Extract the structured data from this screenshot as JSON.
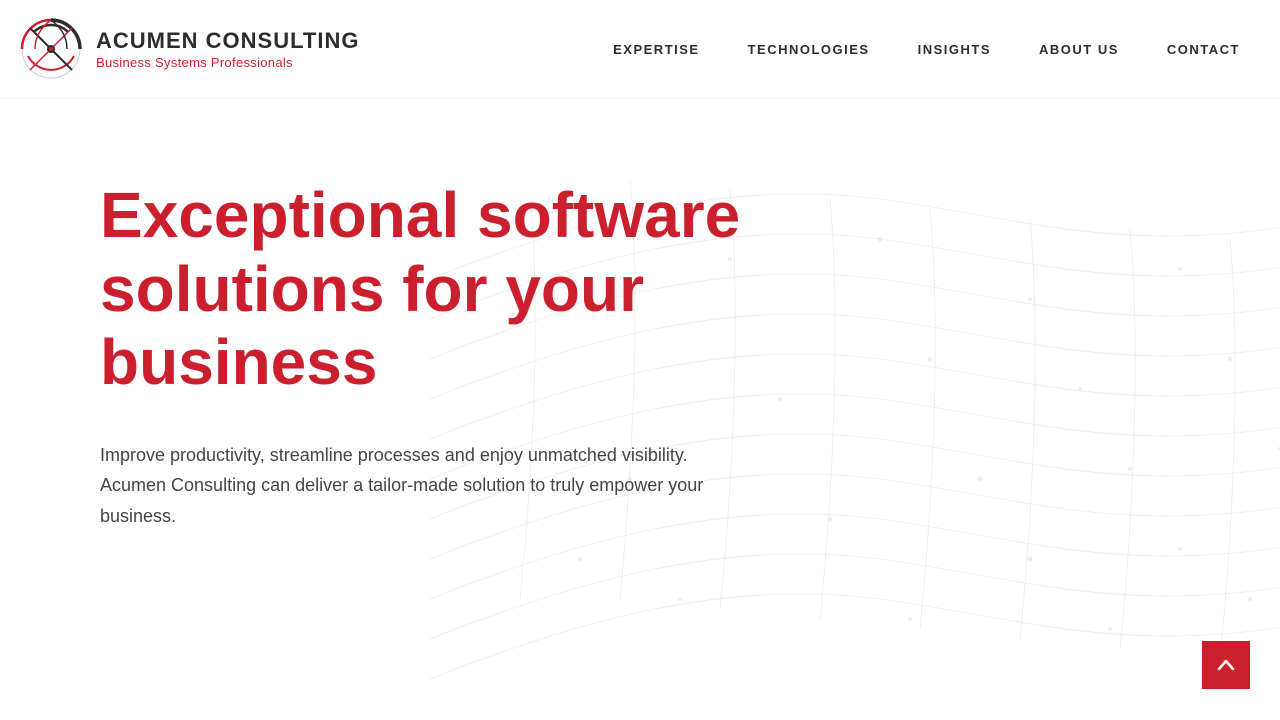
{
  "header": {
    "logo": {
      "title": "ACUMEN CONSULTING",
      "subtitle": "Business Systems Professionals"
    },
    "nav": {
      "items": [
        {
          "label": "EXPERTISE",
          "id": "expertise"
        },
        {
          "label": "TECHNOLOGIES",
          "id": "technologies"
        },
        {
          "label": "INSIGHTS",
          "id": "insights"
        },
        {
          "label": "ABOUT US",
          "id": "about"
        },
        {
          "label": "CONTACT",
          "id": "contact"
        }
      ]
    }
  },
  "hero": {
    "title": "Exceptional software solutions for your business",
    "description": "Improve productivity, streamline processes and enjoy unmatched visibility. Acumen Consulting can deliver a tailor-made solution to truly empower your business."
  },
  "scroll_top": {
    "label": "↑"
  },
  "colors": {
    "brand_red": "#cc1f2e",
    "dark_text": "#2d2d2d",
    "body_text": "#444444"
  }
}
